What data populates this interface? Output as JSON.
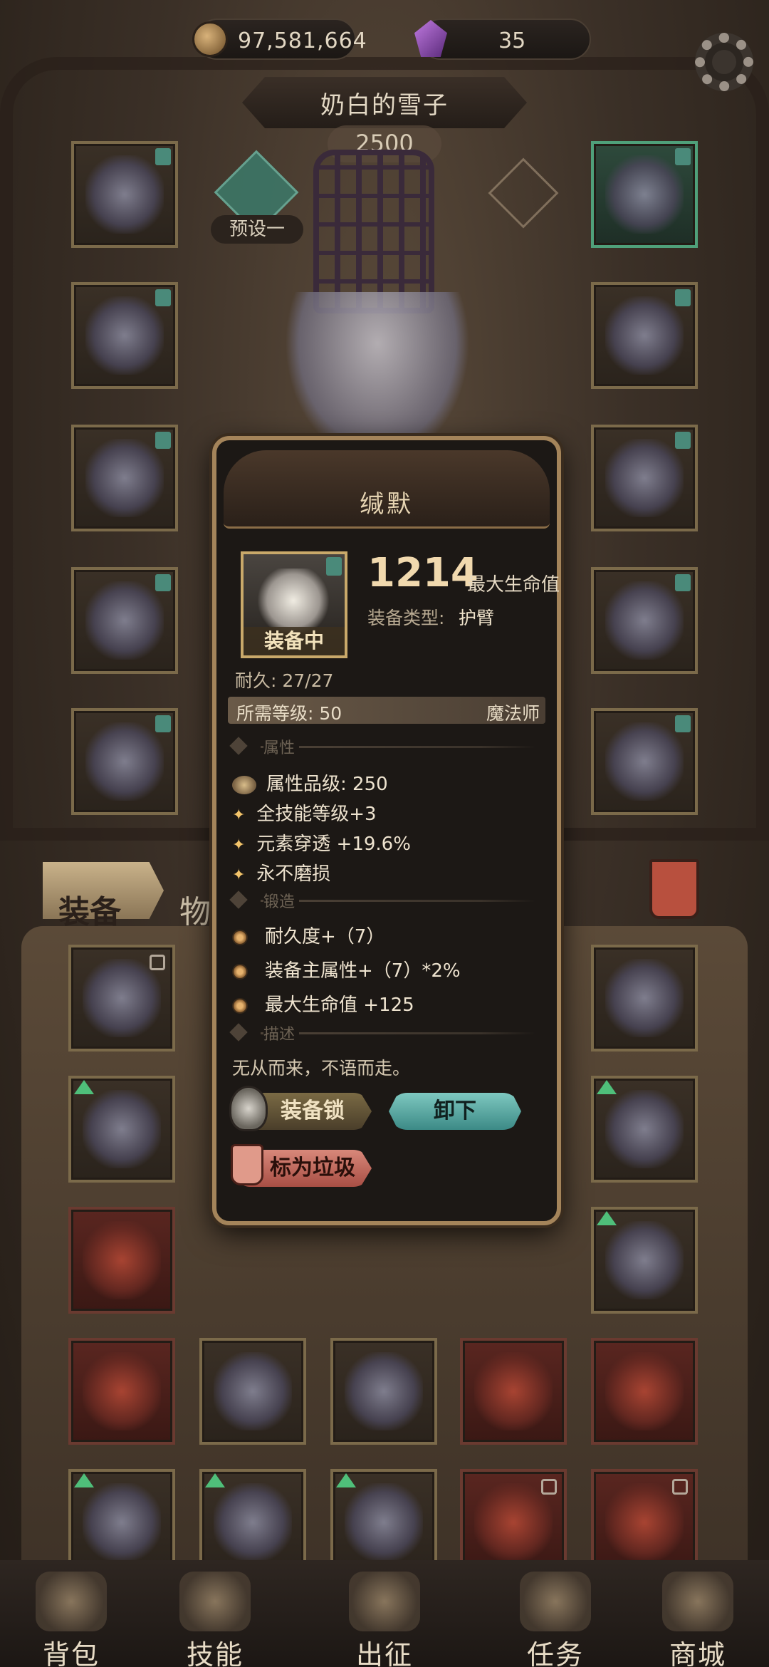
{
  "currency": {
    "gold": "97,581,664",
    "gems": "35"
  },
  "character": {
    "name": "奶白的雪子",
    "power": "2500",
    "preset_label": "预设一"
  },
  "tabs": {
    "equipment": "装备",
    "items": "物品"
  },
  "nav": [
    {
      "label": "背包",
      "icon": "backpack-icon"
    },
    {
      "label": "技能",
      "icon": "skill-book-icon"
    },
    {
      "label": "出征",
      "icon": "helmet-icon"
    },
    {
      "label": "任务",
      "icon": "scroll-icon"
    },
    {
      "label": "商城",
      "icon": "shop-crown-icon"
    }
  ],
  "item_detail": {
    "name": "缄默",
    "equipped_label": "装备中",
    "main_stat_value": "1214",
    "main_stat_name": "最大生命值",
    "equip_type_label": "装备类型:",
    "equip_type_value": "护臂",
    "durability": "耐久: 27/27",
    "required_level": "所需等级: 50",
    "required_class": "魔法师",
    "sections": {
      "attributes": "属性",
      "forge": "锻造",
      "description": "描述"
    },
    "attributes": [
      "属性品级: 250",
      "全技能等级+3",
      "元素穿透 +19.6%",
      "永不磨损"
    ],
    "forge_stats": [
      "耐久度+（7）",
      "装备主属性+（7）*2%",
      "最大生命值 +125"
    ],
    "description": "无从而来，不语而走。",
    "buttons": {
      "lock": "装备锁",
      "unequip": "卸下",
      "mark_junk": "标为垃圾"
    }
  },
  "colors": {
    "accent_gold": "#c9a96a",
    "teal_button": "#5fb3ad",
    "junk_button": "#c96a5e"
  }
}
